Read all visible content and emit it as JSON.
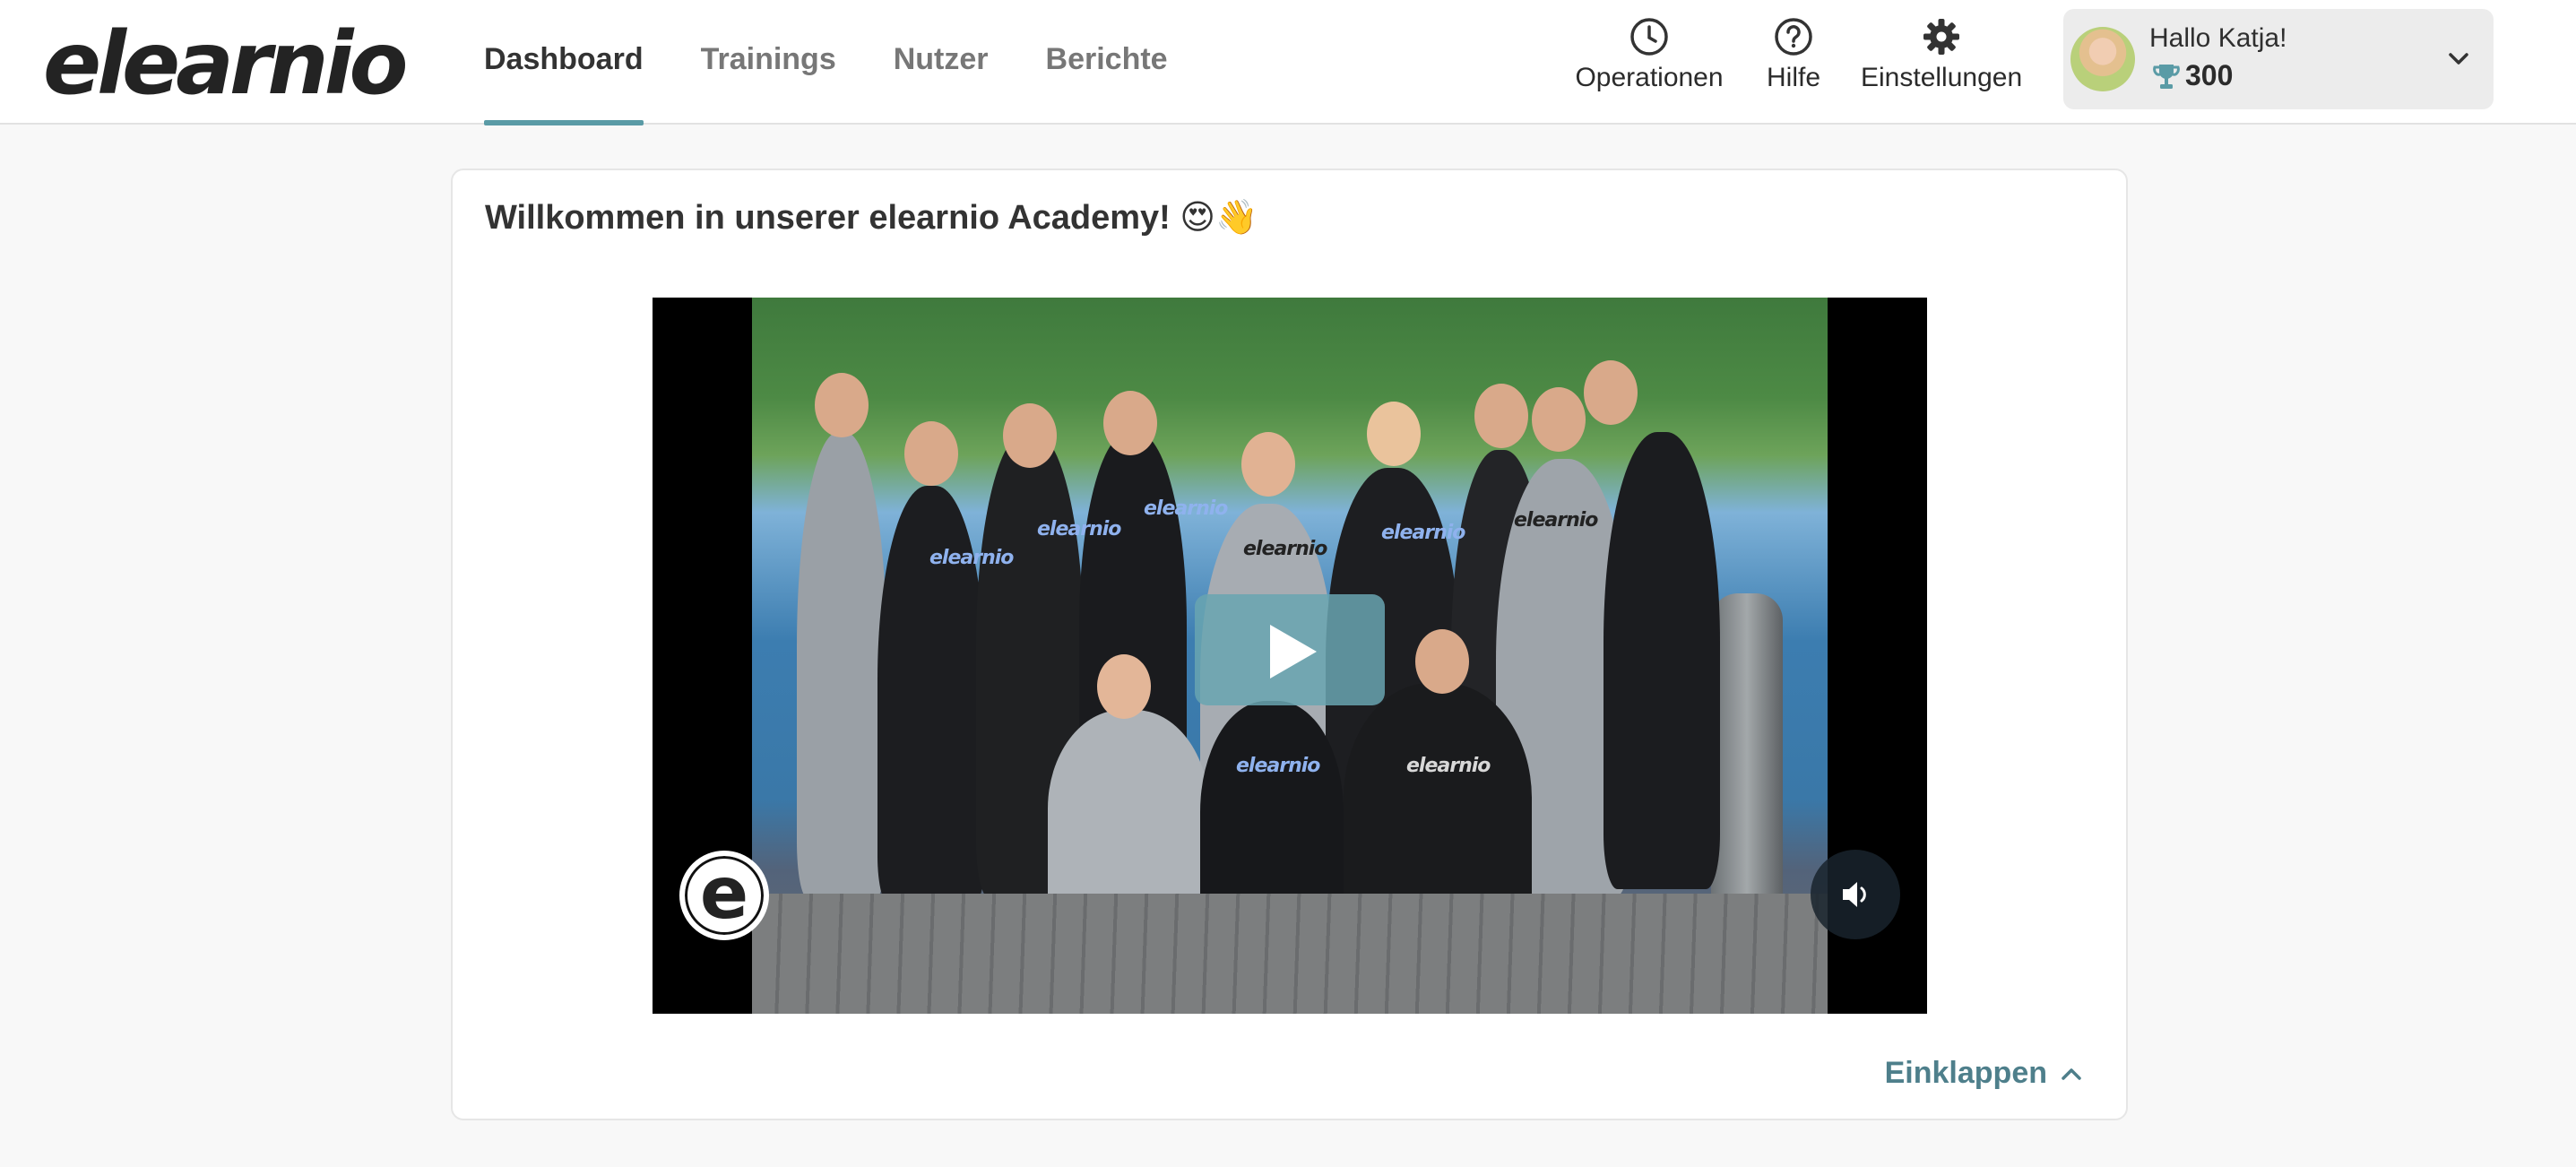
{
  "header": {
    "logo": "elearnio",
    "nav": [
      {
        "label": "Dashboard",
        "active": true
      },
      {
        "label": "Trainings",
        "active": false
      },
      {
        "label": "Nutzer",
        "active": false
      },
      {
        "label": "Berichte",
        "active": false
      }
    ],
    "actions": {
      "operations": {
        "label": "Operationen",
        "icon": "clock-icon"
      },
      "help": {
        "label": "Hilfe",
        "icon": "question-circle-icon"
      },
      "settings": {
        "label": "Einstellungen",
        "icon": "gear-icon"
      }
    },
    "user": {
      "greeting": "Hallo Katja!",
      "points": "300",
      "points_icon": "trophy-icon"
    }
  },
  "card": {
    "title": "Willkommen in unserer elearnio Academy! 😍👋",
    "video": {
      "play_icon": "play-icon",
      "mute_icon": "speaker-icon",
      "badge_letter": "e",
      "hoodie_text": "elearnio"
    },
    "collapse_label": "Einklappen"
  },
  "colors": {
    "accent": "#5a9ba6",
    "collapse_text": "#4e7f8b",
    "play_button": "#68a4b0",
    "trophy": "#5a9ba6"
  }
}
